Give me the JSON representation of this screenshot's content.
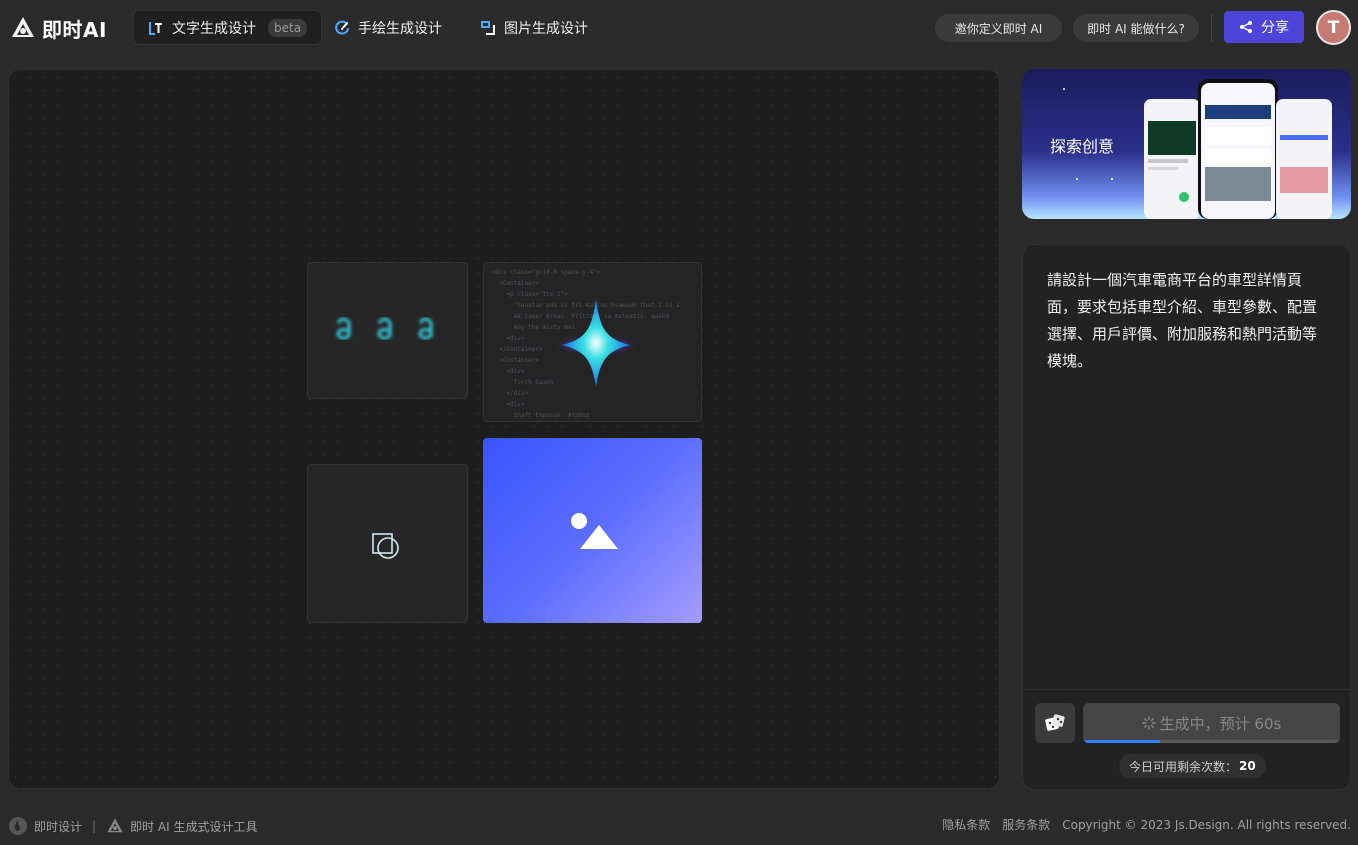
{
  "header": {
    "logo_text": "即时AI",
    "tabs": [
      {
        "label": "文字生成设计",
        "badge": "beta",
        "icon": "text-gen-icon"
      },
      {
        "label": "手绘生成设计",
        "icon": "sketch-gen-icon"
      },
      {
        "label": "图片生成设计",
        "icon": "image-gen-icon"
      }
    ],
    "invite_label": "邀你定义即时 AI",
    "about_label": "即时 AI 能做什么?",
    "share_label": "分享",
    "avatar_letter": "T"
  },
  "canvas": {
    "code_snippet": "<div class=\"grid-0 space-y-4\">\n  <Container>\n    <p class=\"ttx-2\">\n      \"Sanatan pde si tri-Kalinu hsawuuh that I is s\n      ak tamer broan. Fritrams sa matwatio. aaakd\n      Any the mixty mxi\n    <div>\n  </Container>\n  <Container>\n    <div>\n      Torch Saxon\n    </div>\n    <div>\n      Shaft Exposun. Atpboz"
  },
  "banner": {
    "title": "探索创意"
  },
  "prompt": {
    "text": "請設計一個汽車電商平台的車型詳情頁面，要求包括車型介紹、車型參數、配置選擇、用戶評價、附加服務和熱門活動等模塊。",
    "generate_label": "生成中，预计 60s",
    "progress": 0.3,
    "quota_label": "今日可用剩余次数：",
    "quota_value": "20"
  },
  "footer": {
    "brand": "即时设计",
    "product": "即时 AI 生成式设计工具",
    "privacy": "隐私条款",
    "service": "服务条款",
    "copyright": "Copyright © 2023 Js.Design. All rights reserved."
  },
  "colors": {
    "accent": "#4d45d9",
    "progress": "#2f7fff",
    "avatar": "#c77a72"
  }
}
